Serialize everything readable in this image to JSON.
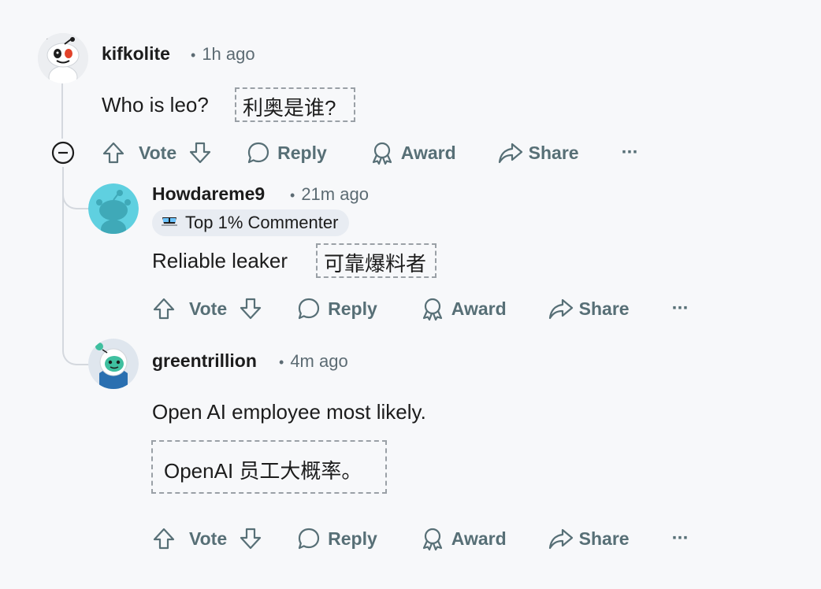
{
  "comments": [
    {
      "username": "kifkolite",
      "time": "1h ago",
      "text": "Who is leo?",
      "translation": "利奥是谁?"
    },
    {
      "username": "Howdareme9",
      "time": "21m ago",
      "badge": "Top 1% Commenter",
      "text": "Reliable leaker",
      "translation": "可靠爆料者"
    },
    {
      "username": "greentrillion",
      "time": "4m ago",
      "text": "Open AI employee most likely.",
      "translation": "OpenAI 员工大概率。"
    }
  ],
  "actions": {
    "vote": "Vote",
    "reply": "Reply",
    "award": "Award",
    "share": "Share",
    "more": "···"
  },
  "separator": "•",
  "colors": {
    "background": "#f7f8fa",
    "meta": "#5c6b73",
    "action": "#576f76",
    "thread_line": "#d4d8de",
    "avatar2_bg": "#5fd0e0",
    "avatar3_bg": "#dfe6ee"
  },
  "icons": [
    "collapse-icon",
    "upvote-icon",
    "downvote-icon",
    "reply-icon",
    "award-icon",
    "share-icon",
    "more-icon",
    "glasses-icon"
  ]
}
